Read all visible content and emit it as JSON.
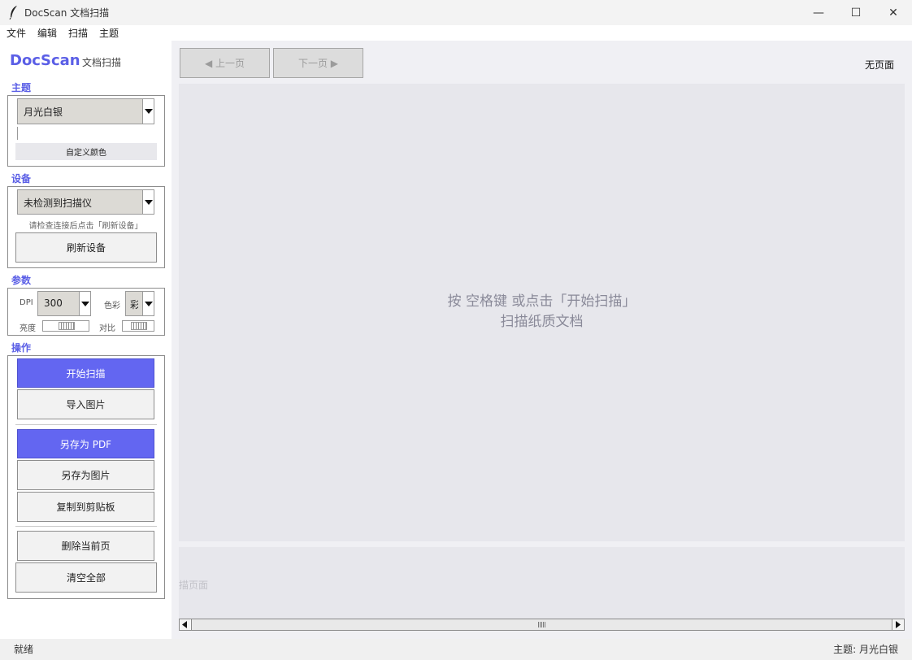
{
  "window": {
    "title": "DocScan  文档扫描",
    "controls": {
      "minimize": "—",
      "maximize": "☐",
      "close": "✕"
    }
  },
  "menu": [
    "文件",
    "编辑",
    "扫描",
    "主题"
  ],
  "sidebar": {
    "brand": "DocScan",
    "brand_sub": "文档扫描",
    "theme": {
      "heading": "主题",
      "selected": "月光白银",
      "custom_color_label": "自定义颜色"
    },
    "device": {
      "heading": "设备",
      "selected": "未检测到扫描仪",
      "hint": "请检查连接后点击「刷新设备」",
      "refresh_label": "刷新设备"
    },
    "params": {
      "heading": "参数",
      "dpi_label": "DPI",
      "dpi_value": "300",
      "color_label": "色彩",
      "color_value": "彩",
      "brightness_label": "亮度",
      "contrast_label": "对比"
    },
    "actions": {
      "heading": "操作",
      "start_scan": "开始扫描",
      "import_image": "导入图片",
      "save_pdf": "另存为 PDF",
      "save_image": "另存为图片",
      "copy_clipboard": "复制到剪贴板",
      "delete_page": "删除当前页",
      "clear_all": "清空全部"
    }
  },
  "viewer": {
    "prev_label": "◀ 上一页",
    "next_label": "下一页 ▶",
    "page_indicator": "无页面",
    "hint_line1": "按 空格键 或点击「开始扫描」",
    "hint_line2": "扫描纸质文档",
    "thumb_placeholder": "描页面"
  },
  "status": {
    "left": "就绪",
    "right": "主题: 月光白银"
  },
  "colors": {
    "accent": "#6366f1",
    "accent_text": "#5b5fe6"
  }
}
